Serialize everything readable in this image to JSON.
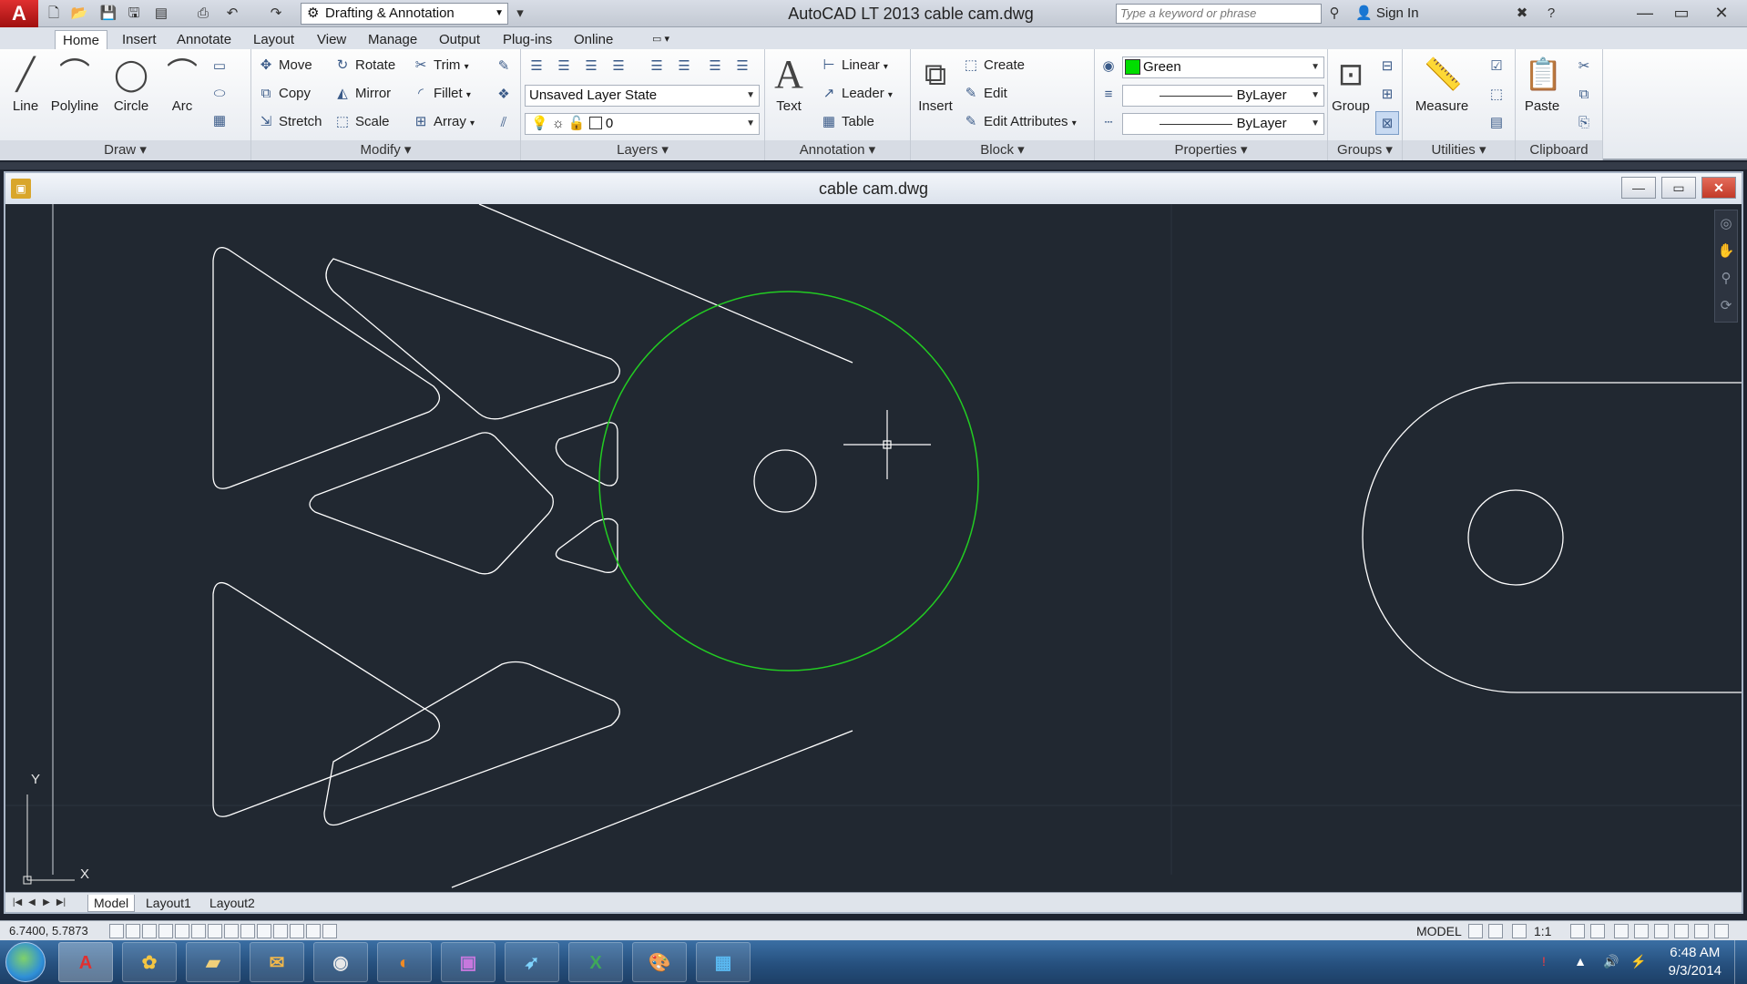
{
  "titlebar": {
    "app_title": "AutoCAD LT 2013    cable cam.dwg",
    "workspace": "Drafting & Annotation",
    "search_placeholder": "Type a keyword or phrase",
    "sign_in": "Sign In",
    "minimize": "—",
    "maximize": "▭",
    "close": "✕"
  },
  "ribbon_tabs": [
    "Home",
    "Insert",
    "Annotate",
    "Layout",
    "View",
    "Manage",
    "Output",
    "Plug-ins",
    "Online"
  ],
  "draw": {
    "title": "Draw",
    "line": "Line",
    "polyline": "Polyline",
    "circle": "Circle",
    "arc": "Arc"
  },
  "modify": {
    "title": "Modify",
    "move": "Move",
    "rotate": "Rotate",
    "trim": "Trim",
    "copy": "Copy",
    "mirror": "Mirror",
    "fillet": "Fillet",
    "stretch": "Stretch",
    "scale": "Scale",
    "array": "Array"
  },
  "layers": {
    "title": "Layers",
    "layer_state": "Unsaved Layer State",
    "current_layer": "0"
  },
  "annotation": {
    "title": "Annotation",
    "text": "Text",
    "linear": "Linear",
    "leader": "Leader",
    "table": "Table"
  },
  "block": {
    "title": "Block",
    "insert": "Insert",
    "create": "Create",
    "edit": "Edit",
    "edit_attributes": "Edit Attributes"
  },
  "properties": {
    "title": "Properties",
    "color": "Green",
    "color_hex": "#00dd00",
    "linetype": "ByLayer",
    "lineweight": "ByLayer"
  },
  "groups": {
    "title": "Groups",
    "group": "Group"
  },
  "utilities": {
    "title": "Utilities",
    "measure": "Measure"
  },
  "clipboard": {
    "title": "Clipboard",
    "paste": "Paste"
  },
  "document": {
    "title": "cable cam.dwg",
    "minimize": "—",
    "restore": "▭",
    "close": "✕"
  },
  "ucs": {
    "y_label": "Y",
    "x_label": "X"
  },
  "layout_tabs": [
    "Model",
    "Layout1",
    "Layout2"
  ],
  "statusbar": {
    "coords": "6.7400, 5.7873",
    "model": "MODEL",
    "scale": "1:1"
  },
  "taskbar": {
    "apps": [
      "autocad-lt-icon",
      "photo-app-icon",
      "file-explorer-icon",
      "outlook-icon",
      "chrome-icon",
      "firefox-icon",
      "remote-desktop-icon",
      "app-icon",
      "excel-icon",
      "paint-icon",
      "photo-viewer-icon"
    ],
    "time": "6:48 AM",
    "date": "9/3/2014"
  },
  "colors": {
    "canvas_bg": "#212831",
    "geometry": "#ffffff",
    "selected_circle": "#22cc22"
  }
}
